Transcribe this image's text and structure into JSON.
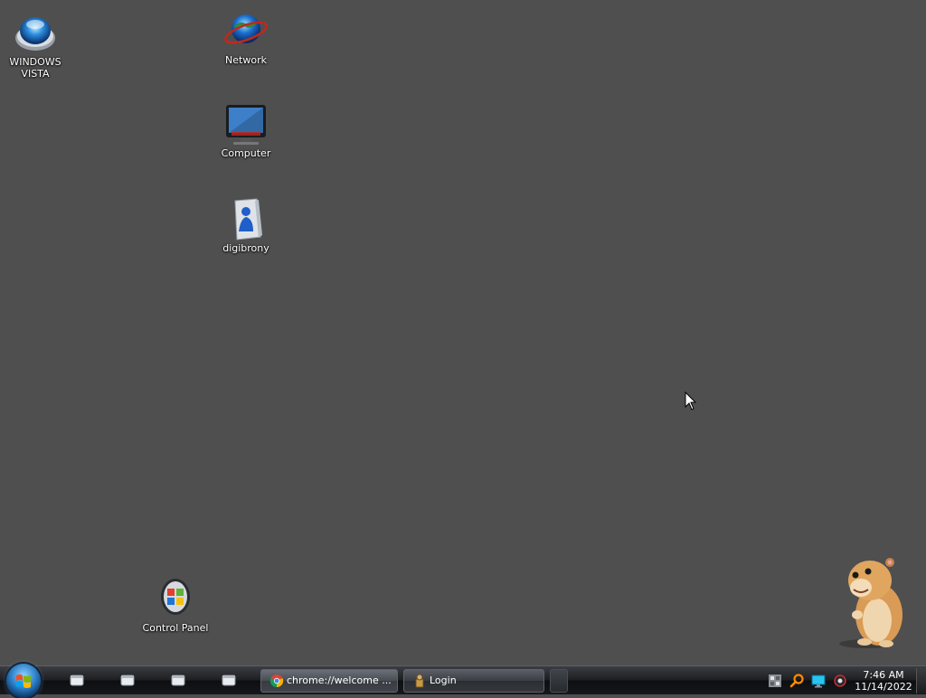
{
  "desktop": {
    "icons": [
      {
        "label": "WINDOWS\nVISTA",
        "icon": "vista-orb-icon"
      },
      {
        "label": "Network",
        "icon": "network-globe-icon"
      },
      {
        "label": "Computer",
        "icon": "computer-monitor-icon"
      },
      {
        "label": "digibrony",
        "icon": "user-folder-icon"
      },
      {
        "label": "Control Panel",
        "icon": "control-panel-icon"
      }
    ],
    "background_color": "#4f4f4f"
  },
  "taskbar": {
    "start_icon": "windows-start-orb-icon",
    "quick_launch": [
      "window-icon",
      "window-icon",
      "window-icon",
      "window-icon"
    ],
    "tasks": [
      {
        "label": "chrome://welcome ...",
        "icon": "chrome-icon",
        "active": true
      },
      {
        "label": "Login",
        "icon": "login-app-icon",
        "active": false
      }
    ],
    "tray_icons": [
      "network-tray-icon",
      "search-tray-icon",
      "display-tray-icon",
      "volume-tray-icon"
    ],
    "clock": {
      "time": "7:46 AM",
      "date": "11/14/2022"
    }
  }
}
